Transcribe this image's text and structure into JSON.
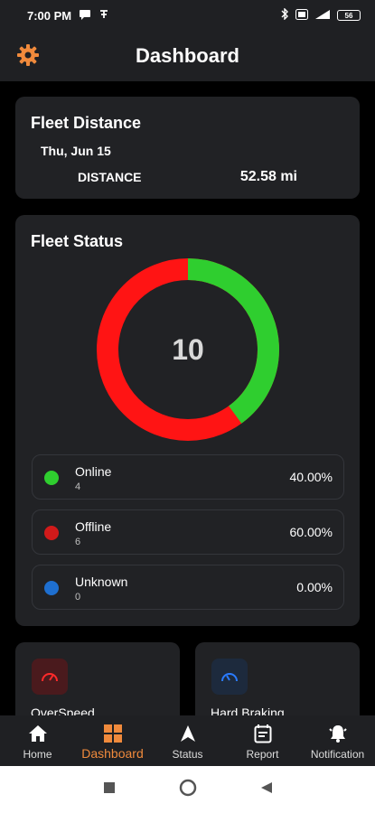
{
  "status_bar": {
    "time": "7:00 PM",
    "battery": "56"
  },
  "header": {
    "title": "Dashboard"
  },
  "fleet_distance": {
    "title": "Fleet Distance",
    "date": "Thu, Jun 15",
    "label": "DISTANCE",
    "value": "52.58 mi"
  },
  "fleet_status": {
    "title": "Fleet Status",
    "total": "10",
    "items": [
      {
        "name": "Online",
        "count": "4",
        "percent": "40.00%",
        "color": "#2fce2f"
      },
      {
        "name": "Offline",
        "count": "6",
        "percent": "60.00%",
        "color": "#ff1414"
      },
      {
        "name": "Unknown",
        "count": "0",
        "percent": "0.00%",
        "color": "#1e6fd0"
      }
    ]
  },
  "cards": {
    "overspeed": "OverSpeed",
    "hard_braking": "Hard Braking"
  },
  "nav": {
    "home": "Home",
    "dashboard": "Dashboard",
    "status": "Status",
    "report": "Report",
    "notification": "Notification"
  },
  "colors": {
    "accent": "#f08a3c",
    "online": "#2fce2f",
    "offline": "#ff1414",
    "unknown": "#1e6fd0",
    "card_bg": "#212225"
  }
}
